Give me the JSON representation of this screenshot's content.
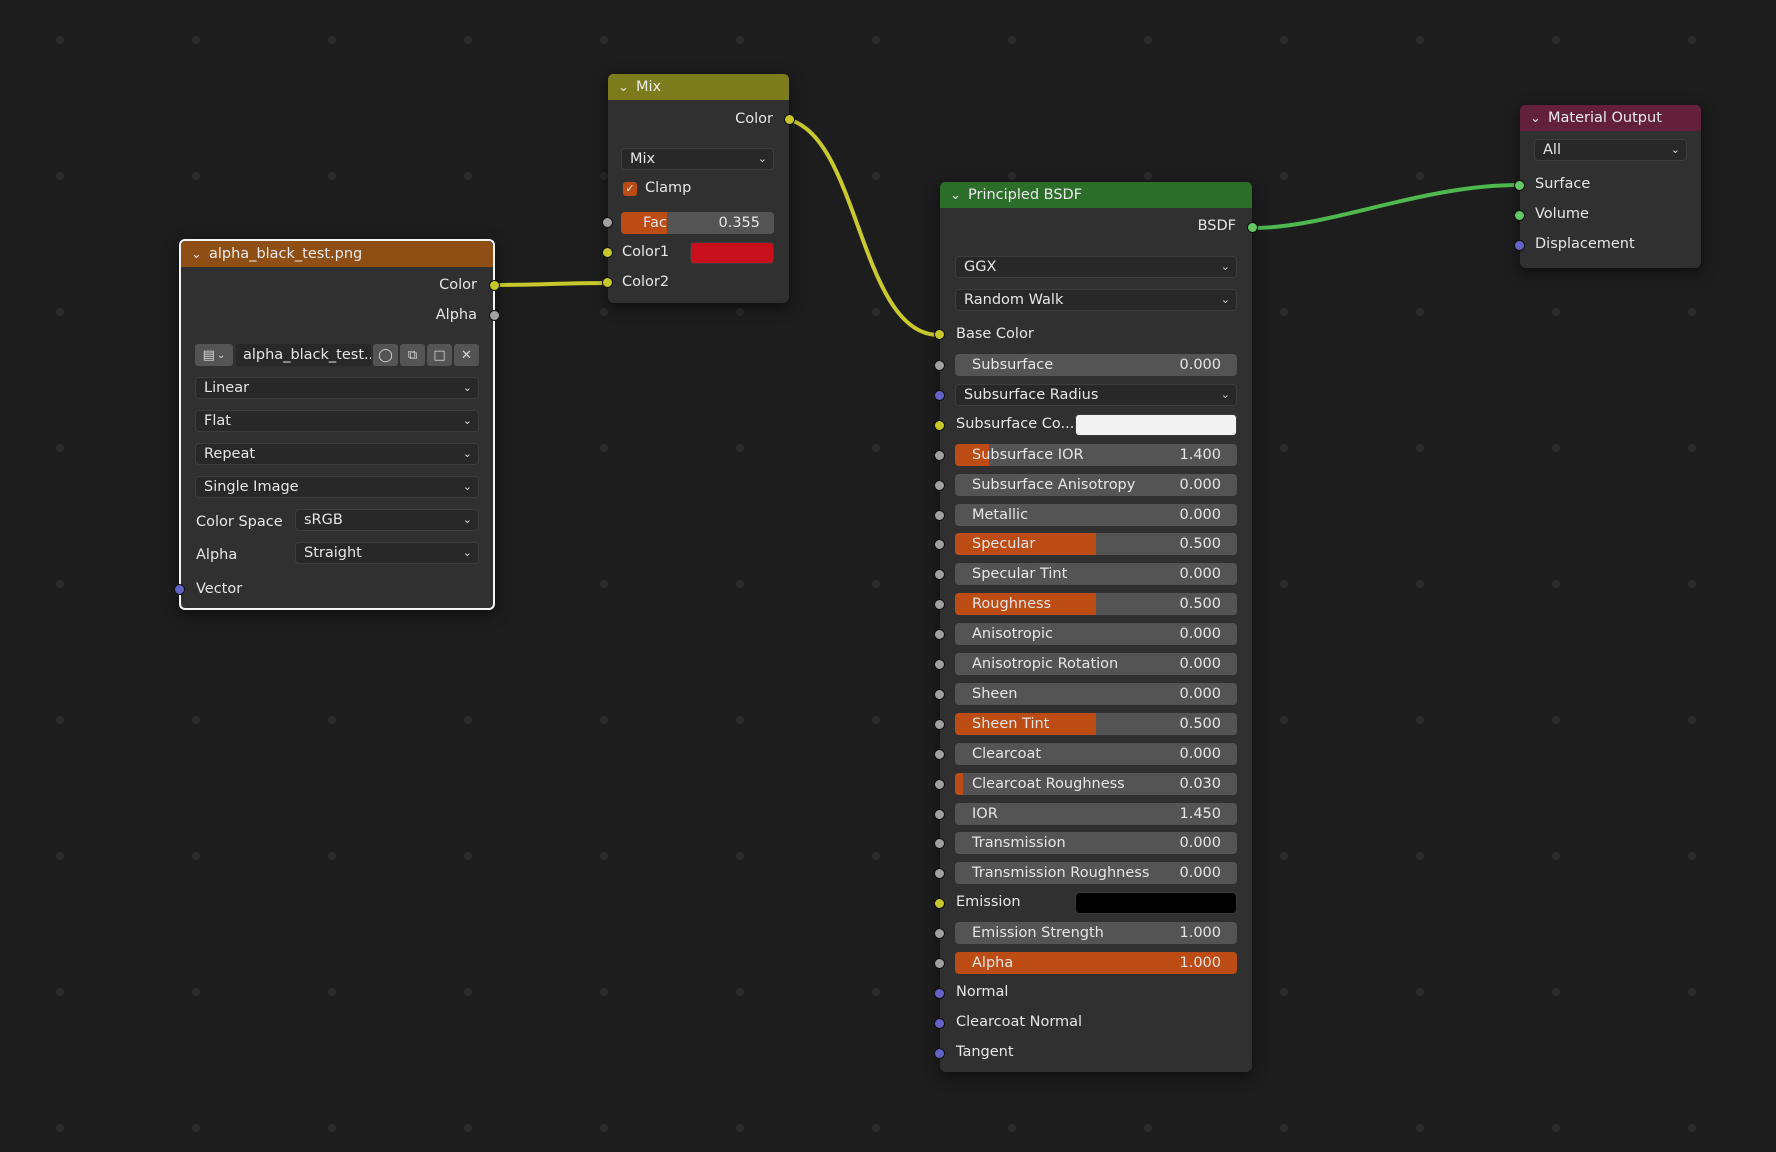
{
  "colors": {
    "image_header": "#8f4e14",
    "mix_header": "#7c7c1c",
    "bsdf_header": "#2d6d2a",
    "output_header": "#62203a",
    "accent": "#bd4b14",
    "wire_yellow": "#c9c92e",
    "wire_green": "#4fb84f"
  },
  "image_node": {
    "title": "alpha_black_test.png",
    "outputs": [
      "Color",
      "Alpha"
    ],
    "image_name": "alpha_black_test...",
    "image_icon": "image-icon",
    "interpolation": "Linear",
    "projection": "Flat",
    "extension": "Repeat",
    "source": "Single Image",
    "color_space_label": "Color Space",
    "color_space": "sRGB",
    "alpha_label": "Alpha",
    "alpha_mode": "Straight",
    "input_vector": "Vector"
  },
  "mix_node": {
    "title": "Mix",
    "output": "Color",
    "blend_type": "Mix",
    "clamp_label": "Clamp",
    "clamp_checked": true,
    "fac_label": "Fac",
    "fac_value": "0.355",
    "fac_fraction": 0.355,
    "color1_label": "Color1",
    "color1_swatch": "#c8101c",
    "color2_label": "Color2"
  },
  "bsdf_node": {
    "title": "Principled BSDF",
    "output": "BSDF",
    "distribution": "GGX",
    "subsurface_method": "Random Walk",
    "base_color_label": "Base Color",
    "subsurface_radius": "Subsurface Radius",
    "subsurface_color_label": "Subsurface Co...",
    "subsurface_color_swatch": "#f2f2f2",
    "emission_label": "Emission",
    "emission_swatch": "#000000",
    "sliders": [
      {
        "label": "Subsurface",
        "value": "0.000",
        "fill": 0.0
      },
      {
        "label": "Subsurface IOR",
        "value": "1.400",
        "fill": 0.12
      },
      {
        "label": "Subsurface Anisotropy",
        "value": "0.000",
        "fill": 0.0
      },
      {
        "label": "Metallic",
        "value": "0.000",
        "fill": 0.0
      },
      {
        "label": "Specular",
        "value": "0.500",
        "fill": 0.5
      },
      {
        "label": "Specular Tint",
        "value": "0.000",
        "fill": 0.0
      },
      {
        "label": "Roughness",
        "value": "0.500",
        "fill": 0.5
      },
      {
        "label": "Anisotropic",
        "value": "0.000",
        "fill": 0.0
      },
      {
        "label": "Anisotropic Rotation",
        "value": "0.000",
        "fill": 0.0
      },
      {
        "label": "Sheen",
        "value": "0.000",
        "fill": 0.0
      },
      {
        "label": "Sheen Tint",
        "value": "0.500",
        "fill": 0.5
      },
      {
        "label": "Clearcoat",
        "value": "0.000",
        "fill": 0.0
      },
      {
        "label": "Clearcoat Roughness",
        "value": "0.030",
        "fill": 0.03
      },
      {
        "label": "IOR",
        "value": "1.450",
        "fill": 0.0
      },
      {
        "label": "Transmission",
        "value": "0.000",
        "fill": 0.0
      },
      {
        "label": "Transmission Roughness",
        "value": "0.000",
        "fill": 0.0
      },
      {
        "label": "Emission Strength",
        "value": "1.000",
        "fill": 0.0
      },
      {
        "label": "Alpha",
        "value": "1.000",
        "fill": 1.0
      }
    ],
    "normal_label": "Normal",
    "clearcoat_normal_label": "Clearcoat Normal",
    "tangent_label": "Tangent"
  },
  "output_node": {
    "title": "Material Output",
    "target": "All",
    "inputs": [
      "Surface",
      "Volume",
      "Displacement"
    ]
  }
}
